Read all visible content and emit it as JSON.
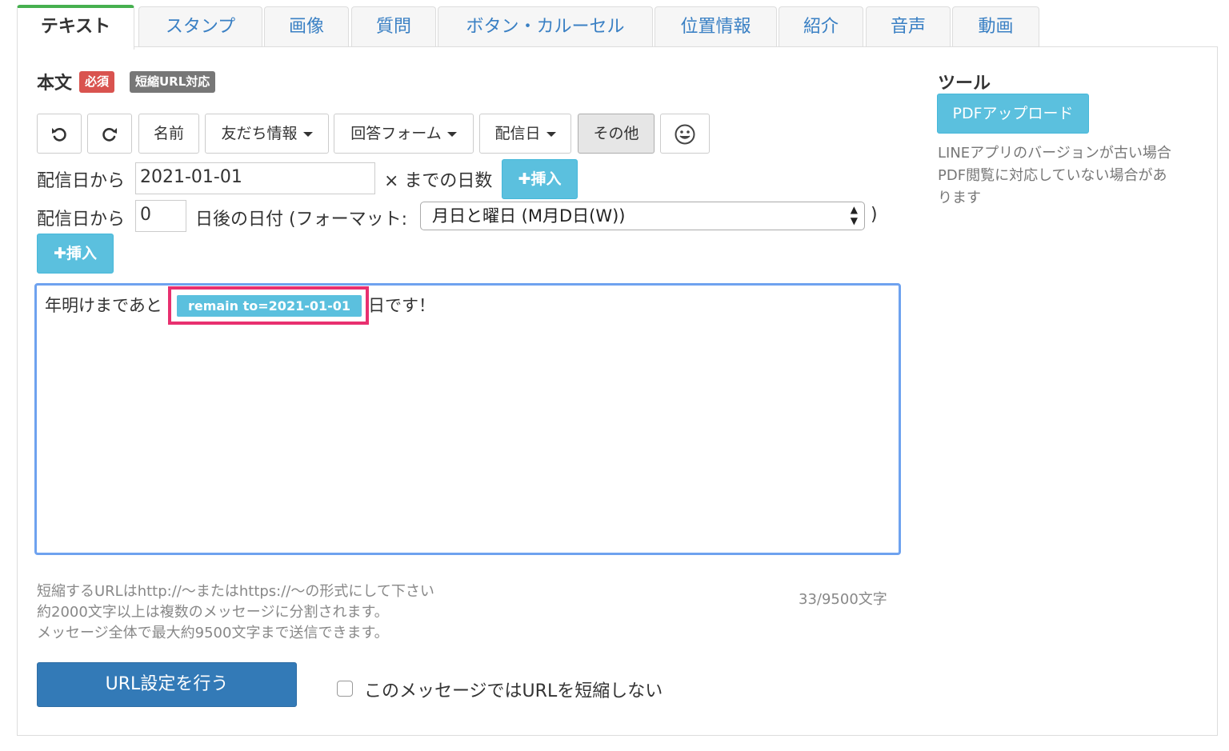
{
  "tabs": [
    {
      "label": "テキスト",
      "active": true
    },
    {
      "label": "スタンプ"
    },
    {
      "label": "画像"
    },
    {
      "label": "質問"
    },
    {
      "label": "ボタン・カルーセル"
    },
    {
      "label": "位置情報"
    },
    {
      "label": "紹介"
    },
    {
      "label": "音声"
    },
    {
      "label": "動画"
    }
  ],
  "body": {
    "label": "本文",
    "required_badge": "必須",
    "short_url_badge": "短縮URL対応"
  },
  "toolbar": {
    "undo_icon": "undo-icon",
    "redo_icon": "redo-icon",
    "name": "名前",
    "friend_info": "友だち情報",
    "answer_form": "回答フォーム",
    "delivery_date": "配信日",
    "other": "その他",
    "emoji_icon": "smiley-icon"
  },
  "days_row": {
    "prefix": "配信日から",
    "date_value": "2021-01-01",
    "suffix": "× までの日数",
    "insert": "✚挿入"
  },
  "date_row": {
    "prefix": "配信日から",
    "offset_value": "0",
    "middle": "日後の日付 (フォーマット:",
    "format_selected": "月日と曜日 (M月D日(W))",
    "close": ")",
    "insert": "✚挿入"
  },
  "editor": {
    "text_before": "年明けまであと",
    "token": "remain to=2021-01-01",
    "text_after": "日です！"
  },
  "help": {
    "line1": "短縮するURLはhttp://〜またはhttps://〜の形式にして下さい",
    "line2": "約2000文字以上は複数のメッセージに分割されます。",
    "line3": "メッセージ全体で最大約9500文字まで送信できます。",
    "count": "33/9500文字"
  },
  "url_button": "URL設定を行う",
  "no_shorten_label": "このメッセージではURLを短縮しない",
  "tools": {
    "title": "ツール",
    "pdf_button": "PDFアップロード",
    "note_line1": "LINEアプリのバージョンが古い場合",
    "note_line2": "PDF閲覧に対応していない場合があ",
    "note_line3": "ります"
  },
  "colors": {
    "active_tab_border": "#46b04f",
    "required_badge": "#d9534f",
    "info_button": "#5bc0de",
    "primary_button": "#337ab7",
    "editor_focus": "#6ea2ef",
    "highlight_box": "#e8306f"
  }
}
